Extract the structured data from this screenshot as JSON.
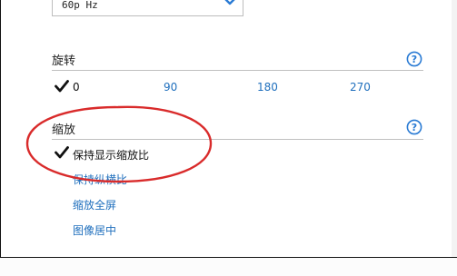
{
  "display": {
    "refresh_rate": "60p Hz"
  },
  "rotation": {
    "title": "旋转",
    "options": [
      {
        "label": "0",
        "selected": true
      },
      {
        "label": "90",
        "selected": false
      },
      {
        "label": "180",
        "selected": false
      },
      {
        "label": "270",
        "selected": false
      }
    ]
  },
  "scaling": {
    "title": "缩放",
    "options": [
      {
        "label": "保持显示缩放比",
        "selected": true
      },
      {
        "label": "保持纵横比",
        "selected": false
      },
      {
        "label": "缩放全屏",
        "selected": false
      },
      {
        "label": "图像居中",
        "selected": false
      }
    ]
  },
  "icons": {
    "help": "help-circle-icon",
    "check": "check-icon",
    "chevron": "chevron-down-icon"
  },
  "colors": {
    "link": "#1f6fbd",
    "accent": "#2a7bd4",
    "annotation": "#d92b2b"
  }
}
